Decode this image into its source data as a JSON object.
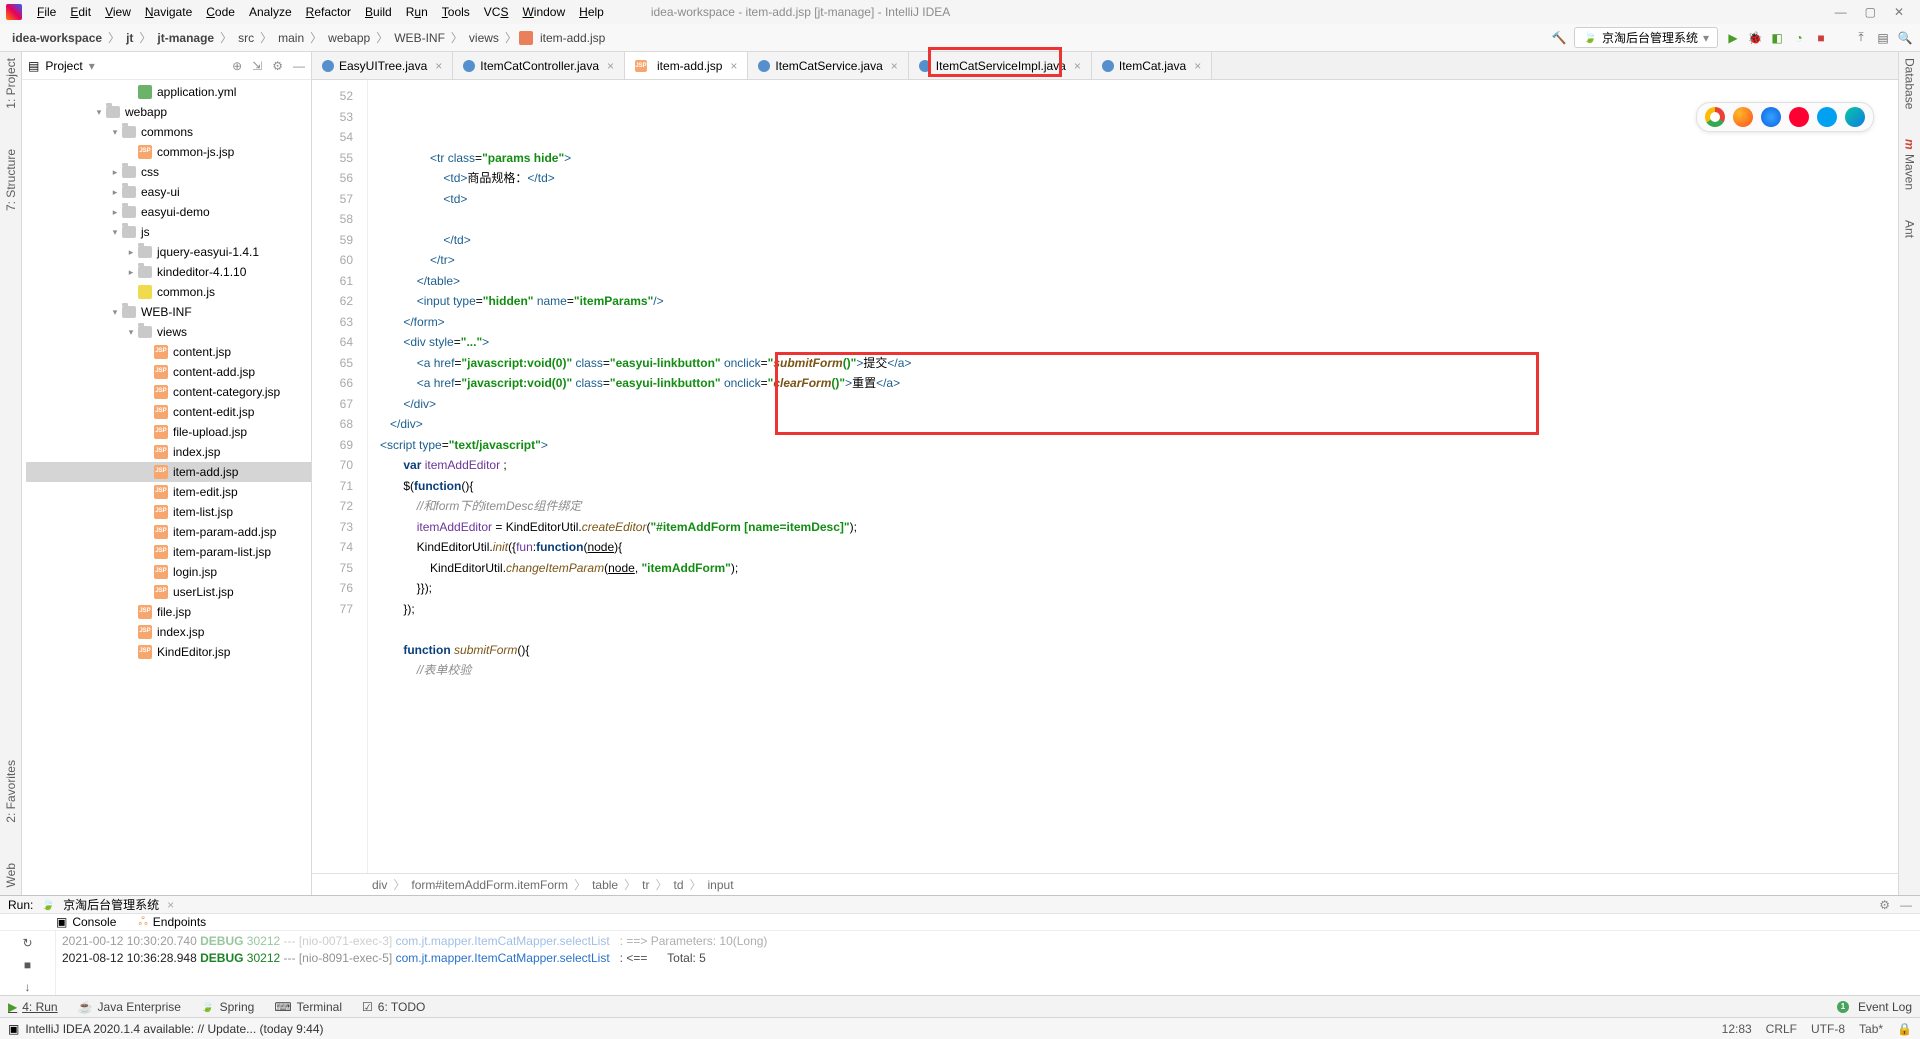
{
  "window": {
    "title": "idea-workspace - item-add.jsp [jt-manage] - IntelliJ IDEA"
  },
  "menu": {
    "file": "File",
    "edit": "Edit",
    "view": "View",
    "navigate": "Navigate",
    "code": "Code",
    "analyze": "Analyze",
    "refactor": "Refactor",
    "build": "Build",
    "run": "Run",
    "tools": "Tools",
    "vcs": "VCS",
    "window": "Window",
    "help": "Help"
  },
  "nav_crumbs": [
    "idea-workspace",
    "jt",
    "jt-manage",
    "src",
    "main",
    "webapp",
    "WEB-INF",
    "views",
    "item-add.jsp"
  ],
  "run_config": "京淘后台管理系统",
  "left_gutter": {
    "project": "1: Project",
    "structure": "7: Structure",
    "favorites": "2: Favorites",
    "web": "Web"
  },
  "right_gutter": {
    "database": "Database",
    "maven": "Maven",
    "ant": "Ant"
  },
  "project": {
    "header": "Project",
    "items": [
      {
        "lvl": 5,
        "type": "yml",
        "label": "application.yml"
      },
      {
        "lvl": 3,
        "type": "folder",
        "label": "webapp",
        "exp": "▾"
      },
      {
        "lvl": 4,
        "type": "folder",
        "label": "commons",
        "exp": "▾"
      },
      {
        "lvl": 5,
        "type": "jsp",
        "label": "common-js.jsp"
      },
      {
        "lvl": 4,
        "type": "folder",
        "label": "css",
        "exp": "▸"
      },
      {
        "lvl": 4,
        "type": "folder",
        "label": "easy-ui",
        "exp": "▸"
      },
      {
        "lvl": 4,
        "type": "folder",
        "label": "easyui-demo",
        "exp": "▸"
      },
      {
        "lvl": 4,
        "type": "folder",
        "label": "js",
        "exp": "▾"
      },
      {
        "lvl": 5,
        "type": "folder",
        "label": "jquery-easyui-1.4.1",
        "exp": "▸"
      },
      {
        "lvl": 5,
        "type": "folder",
        "label": "kindeditor-4.1.10",
        "exp": "▸"
      },
      {
        "lvl": 5,
        "type": "js",
        "label": "common.js"
      },
      {
        "lvl": 4,
        "type": "folder",
        "label": "WEB-INF",
        "exp": "▾"
      },
      {
        "lvl": 5,
        "type": "folder",
        "label": "views",
        "exp": "▾"
      },
      {
        "lvl": 6,
        "type": "jsp",
        "label": "content.jsp"
      },
      {
        "lvl": 6,
        "type": "jsp",
        "label": "content-add.jsp"
      },
      {
        "lvl": 6,
        "type": "jsp",
        "label": "content-category.jsp"
      },
      {
        "lvl": 6,
        "type": "jsp",
        "label": "content-edit.jsp"
      },
      {
        "lvl": 6,
        "type": "jsp",
        "label": "file-upload.jsp"
      },
      {
        "lvl": 6,
        "type": "jsp",
        "label": "index.jsp"
      },
      {
        "lvl": 6,
        "type": "jsp",
        "label": "item-add.jsp",
        "selected": true
      },
      {
        "lvl": 6,
        "type": "jsp",
        "label": "item-edit.jsp"
      },
      {
        "lvl": 6,
        "type": "jsp",
        "label": "item-list.jsp"
      },
      {
        "lvl": 6,
        "type": "jsp",
        "label": "item-param-add.jsp"
      },
      {
        "lvl": 6,
        "type": "jsp",
        "label": "item-param-list.jsp"
      },
      {
        "lvl": 6,
        "type": "jsp",
        "label": "login.jsp"
      },
      {
        "lvl": 6,
        "type": "jsp",
        "label": "userList.jsp"
      },
      {
        "lvl": 5,
        "type": "jsp",
        "label": "file.jsp"
      },
      {
        "lvl": 5,
        "type": "jsp",
        "label": "index.jsp"
      },
      {
        "lvl": 5,
        "type": "jsp",
        "label": "KindEditor.jsp"
      }
    ]
  },
  "editor_tabs": [
    {
      "label": "EasyUITree.java",
      "type": "java"
    },
    {
      "label": "ItemCatController.java",
      "type": "java"
    },
    {
      "label": "item-add.jsp",
      "type": "jsp",
      "active": true
    },
    {
      "label": "ItemCatService.java",
      "type": "java"
    },
    {
      "label": "ItemCatServiceImpl.java",
      "type": "java"
    },
    {
      "label": "ItemCat.java",
      "type": "java"
    }
  ],
  "code": {
    "first_line": 52,
    "lines": [
      {
        "html": "               <span class=c-tag>&lt;tr</span> <span class=c-attr>class</span>=<span class=c-str>\"params hide\"</span><span class=c-tag>&gt;</span>"
      },
      {
        "html": "                   <span class=c-tag>&lt;td&gt;</span>商品规格：<span class=c-tag>&lt;/td&gt;</span>"
      },
      {
        "html": "                   <span class=c-tag>&lt;td&gt;</span>"
      },
      {
        "html": ""
      },
      {
        "html": "                   <span class=c-tag>&lt;/td&gt;</span>"
      },
      {
        "html": "               <span class=c-tag>&lt;/tr&gt;</span>"
      },
      {
        "html": "           <span class=c-tag>&lt;/table&gt;</span>"
      },
      {
        "html": "           <span class=c-tag>&lt;input</span> <span class=c-attr>type</span>=<span class=c-str>\"hidden\"</span> <span class=c-attr>name</span>=<span class=c-str>\"itemParams\"</span><span class=c-tag>/&gt;</span>"
      },
      {
        "html": "       <span class=c-tag>&lt;/form&gt;</span>"
      },
      {
        "html": "       <span class=c-tag>&lt;div</span> <span class=c-attr>style</span>=<span class=c-str>\"...\"</span><span class=c-tag>&gt;</span>"
      },
      {
        "html": "           <span class=c-tag>&lt;a</span> <span class=c-attr>href</span>=<span class=c-str>\"javascript:void(0)\"</span> <span class=c-attr>class</span>=<span class=c-str>\"easyui-linkbutton\"</span> <span class=c-attr>onclick</span>=<span class=c-str>\"<span class=c-fn>submitForm</span>()\"</span><span class=c-tag>&gt;</span>提交<span class=c-tag>&lt;/a&gt;</span>"
      },
      {
        "html": "           <span class=c-tag>&lt;a</span> <span class=c-attr>href</span>=<span class=c-str>\"javascript:void(0)\"</span> <span class=c-attr>class</span>=<span class=c-str>\"easyui-linkbutton\"</span> <span class=c-attr>onclick</span>=<span class=c-str>\"<span class=c-fn>clearForm</span>()\"</span><span class=c-tag>&gt;</span>重置<span class=c-tag>&lt;/a&gt;</span>"
      },
      {
        "html": "       <span class=c-tag>&lt;/div&gt;</span>"
      },
      {
        "html": "   <span class=c-tag>&lt;/div&gt;</span>"
      },
      {
        "html": "<span class=c-tag>&lt;script</span> <span class=c-attr>type</span>=<span class=c-str>\"text/javascript\"</span><span class=c-tag>&gt;</span>"
      },
      {
        "html": "       <span class=c-kw>var</span> <span class=c-pur>itemAddEditor</span> ;"
      },
      {
        "html": "       $(<span class=c-kw>function</span>(){"
      },
      {
        "html": "           <span class=c-cmt>//和<span class=c-it>form</span>下的<span class=c-it>itemDesc</span>组件绑定</span>"
      },
      {
        "html": "           <span class=c-pur>itemAddEditor</span> = KindEditorUtil.<span class=c-fn>createEditor</span>(<span class=c-str>\"#itemAddForm [name=itemDesc]\"</span>);"
      },
      {
        "html": "           KindEditorUtil.<span class=c-fn>init</span>({<span class=c-pur>fun</span>:<span class=c-kw>function</span>(<u>node</u>){"
      },
      {
        "html": "               KindEditorUtil.<span class=c-fn>changeItemParam</span>(<u>node</u>, <span class=c-str>\"itemAddForm\"</span>);"
      },
      {
        "html": "           }});"
      },
      {
        "html": "       });"
      },
      {
        "html": ""
      },
      {
        "html": "       <span class=c-kw>function</span> <span class=c-fn>submitForm</span>(){"
      },
      {
        "html": "           <span class=c-cmt>//表单校验</span>"
      }
    ]
  },
  "breadcrumb": [
    "div",
    "form#itemAddForm.itemForm",
    "table",
    "tr",
    "td",
    "input"
  ],
  "run_panel": {
    "title": "Run:",
    "cfg": "京淘后台管理系统",
    "console": "Console",
    "endpoints": "Endpoints",
    "log1_pre": "2021-00-12 10:30:20.740 ",
    "log1_lvl": "DEBUG",
    "log1_num": " 30212 ",
    "log1_sep": "--- ",
    "log1_thr": "[nio-0071-exec-3] ",
    "log1_pkg": "com.jt.mapper.ItemCatMapper.selectList",
    "log1_post": "   : ==> Parameters: 10(Long)",
    "log2_pre": "2021-08-12 10:36:28.948 ",
    "log2_lvl": "DEBUG",
    "log2_num": " 30212 ",
    "log2_sep": "--- ",
    "log2_thr": "[nio-8091-exec-5] ",
    "log2_pkg": "com.jt.mapper.ItemCatMapper.selectList",
    "log2_post": "   : <==      Total: 5"
  },
  "toolstrip": {
    "run": "4: Run",
    "java_ent": "Java Enterprise",
    "spring": "Spring",
    "terminal": "Terminal",
    "todo": "6: TODO",
    "event_log": "Event Log"
  },
  "status": {
    "msg": "IntelliJ IDEA 2020.1.4 available: // Update... (today 9:44)",
    "pos": "12:83",
    "eol": "CRLF",
    "enc": "UTF-8",
    "tab": "Tab*"
  }
}
